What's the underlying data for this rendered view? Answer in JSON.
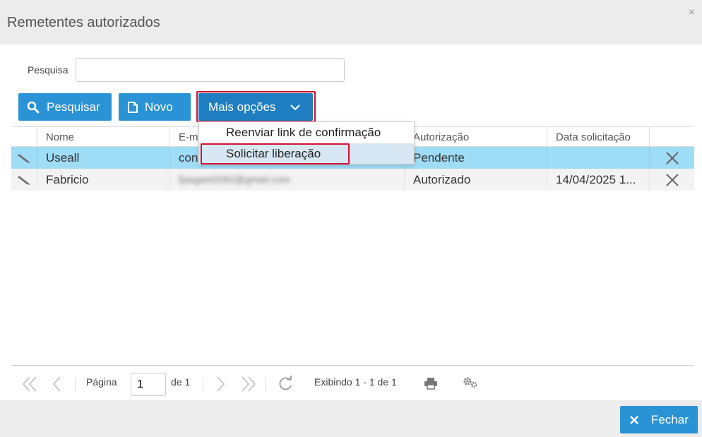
{
  "dialog": {
    "title": "Remetentes autorizados",
    "close_glyph": "×"
  },
  "search": {
    "label": "Pesquisa",
    "value": "",
    "placeholder": ""
  },
  "toolbar": {
    "pesquisar_label": "Pesquisar",
    "novo_label": "Novo",
    "mais_opcoes_label": "Mais opções"
  },
  "dropdown": {
    "items": [
      {
        "label": "Reenviar link de confirmação"
      },
      {
        "label": "Solicitar liberação"
      }
    ]
  },
  "grid": {
    "columns": [
      "Nome",
      "E-m",
      "Autorização",
      "Data solicitação"
    ],
    "rows": [
      {
        "nome": "Useall",
        "email": "con",
        "autorizacao": "Pendente",
        "data": ""
      },
      {
        "nome": "Fabricio",
        "email": "fjasgani2082@gmail.com",
        "autorizacao": "Autorizado",
        "data": "14/04/2025 1..."
      }
    ]
  },
  "pager": {
    "page_label": "Página",
    "page_value": "1",
    "of_label": "de 1",
    "display_label": "Exibindo 1 - 1 de 1"
  },
  "footer": {
    "fechar_label": "Fechar"
  },
  "colors": {
    "primary": "#2a93d5",
    "primary_dark": "#1f7ec2",
    "highlight": "#d6102e",
    "row_selected": "#9fdcf6"
  },
  "icons": [
    "search-icon",
    "document-icon",
    "chevron-down-icon",
    "pencil-icon",
    "delete-icon",
    "first-page-icon",
    "prev-page-icon",
    "next-page-icon",
    "last-page-icon",
    "refresh-icon",
    "print-icon",
    "settings-icon",
    "close-icon"
  ]
}
